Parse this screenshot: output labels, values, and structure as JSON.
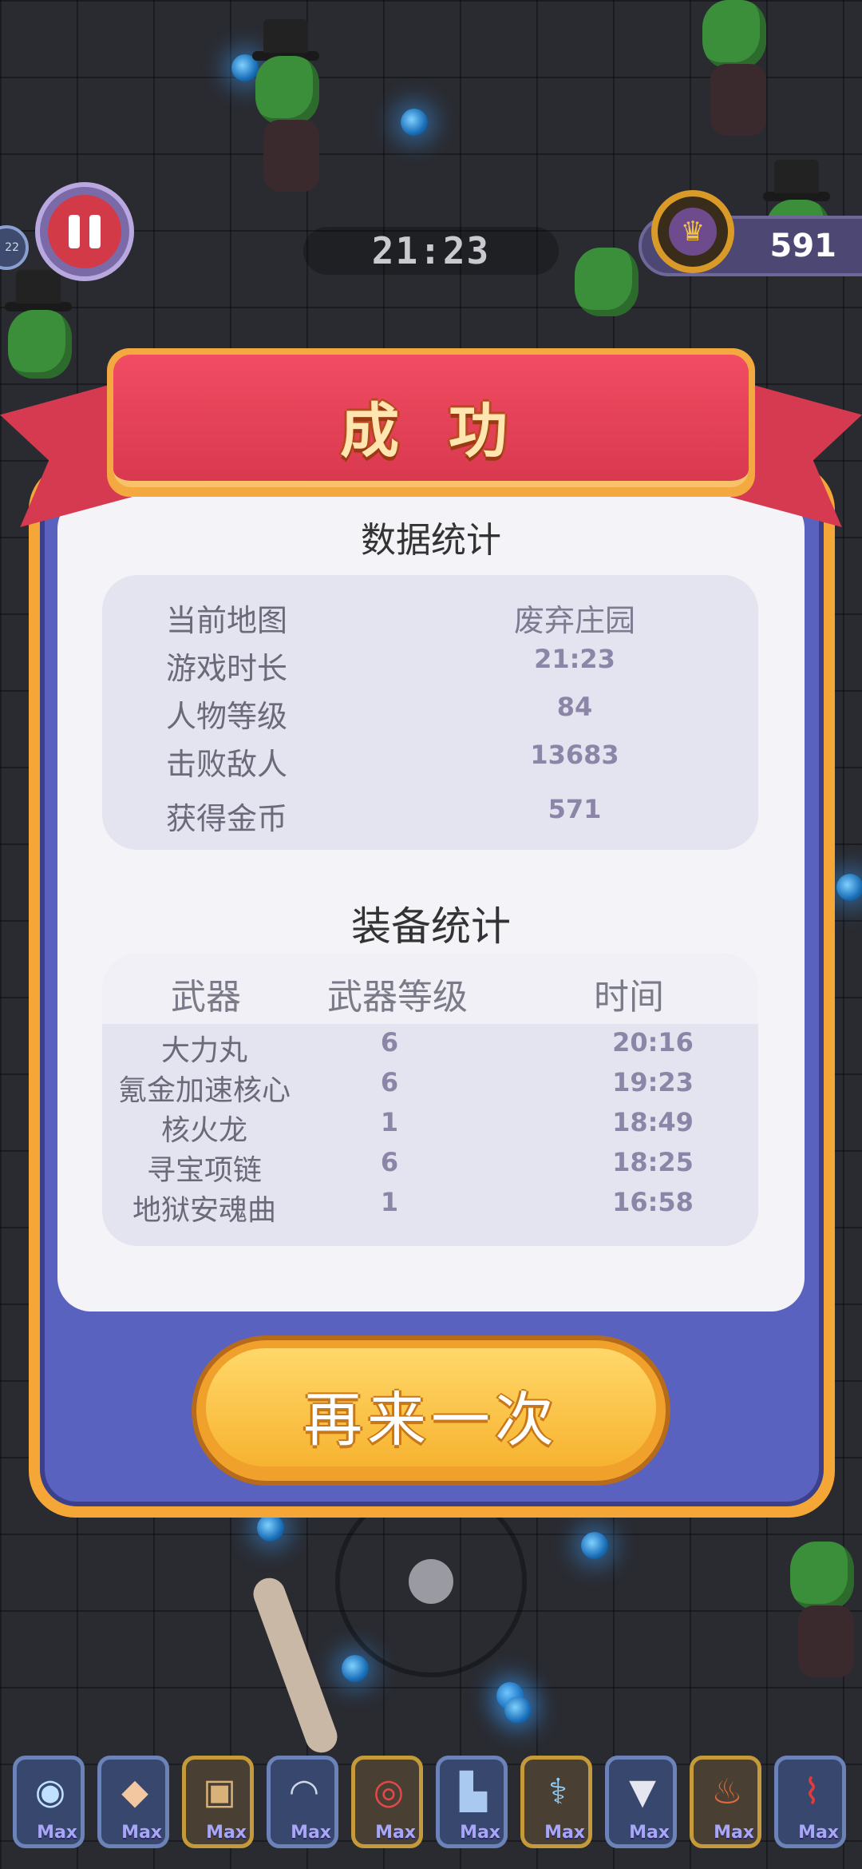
{
  "hud": {
    "timer": "21:23",
    "coins": "591",
    "level_badge": "22"
  },
  "dialog": {
    "title": "成 功",
    "stats_title": "数据统计",
    "stats": [
      {
        "label": "当前地图",
        "value": "废弃庄园"
      },
      {
        "label": "游戏时长",
        "value": "21:23"
      },
      {
        "label": "人物等级",
        "value": "84"
      },
      {
        "label": "击败敌人",
        "value": "13683"
      },
      {
        "label": "获得金币",
        "value": "571"
      }
    ],
    "equip_title": "装备统计",
    "equip_headers": [
      "武器",
      "武器等级",
      "时间"
    ],
    "equipment": [
      {
        "name": "大力丸",
        "level": "6",
        "time": "20:16"
      },
      {
        "name": "氪金加速核心",
        "level": "6",
        "time": "19:23"
      },
      {
        "name": "核火龙",
        "level": "1",
        "time": "18:49"
      },
      {
        "name": "寻宝项链",
        "level": "6",
        "time": "18:25"
      },
      {
        "name": "地狱安魂曲",
        "level": "1",
        "time": "16:58"
      }
    ],
    "retry_label": "再来一次"
  },
  "items": [
    {
      "icon": "blue-orb-icon",
      "label": "Max"
    },
    {
      "icon": "crystal-icon",
      "label": "Max"
    },
    {
      "icon": "gold-armor-icon",
      "label": "Max"
    },
    {
      "icon": "helmet-icon",
      "label": "Max"
    },
    {
      "icon": "red-ring-icon",
      "label": "Max"
    },
    {
      "icon": "boot-icon",
      "label": "Max"
    },
    {
      "icon": "wand-icon",
      "label": "Max"
    },
    {
      "icon": "wings-icon",
      "label": "Max"
    },
    {
      "icon": "torch-icon",
      "label": "Max"
    },
    {
      "icon": "chili-icon",
      "label": "Max"
    }
  ],
  "colors": {
    "accent_red": "#d9394f",
    "button_gold": "#f7b330",
    "panel_blue": "#5a62bf"
  }
}
